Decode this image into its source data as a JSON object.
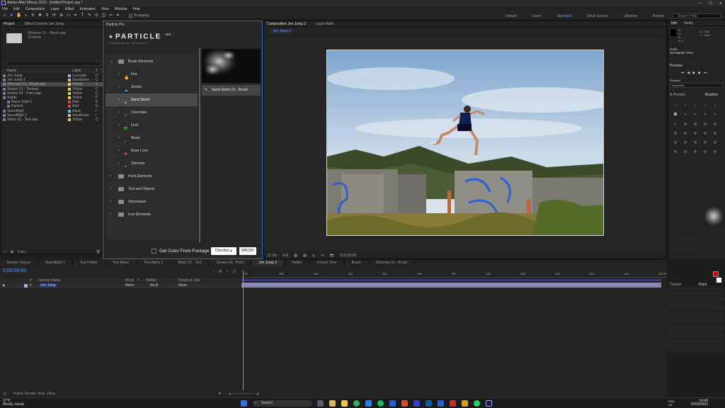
{
  "window": {
    "title": "Adobe After Effects 2023 - Untitled Project.aep *",
    "controls": [
      "—",
      "☐",
      "✕"
    ]
  },
  "menu": [
    "File",
    "Edit",
    "Composition",
    "Layer",
    "Effect",
    "Animation",
    "View",
    "Window",
    "Help"
  ],
  "toolbar": {
    "snapping": "Snapping"
  },
  "workspaces": {
    "items": [
      "Default",
      "Learn",
      "Standard",
      "Small Screen",
      "Libraries",
      "Review"
    ],
    "active": "Standard",
    "search_placeholder": "Search Help"
  },
  "project": {
    "tabs": [
      "Project",
      "Effect Controls Jon Jump"
    ],
    "selected_name": "Shimmer 01 - Brush.aep",
    "selected_info": "12 items",
    "header": {
      "name": "Name",
      "label": "Label",
      "type": "T"
    },
    "rows": [
      {
        "name": "Jon Jump",
        "label": "Lavender",
        "color": "#b7a6de",
        "type": "C"
      },
      {
        "name": "Jon Jump 2",
        "label": "Sandstone",
        "color": "#d8c08a",
        "type": "C"
      },
      {
        "name": "Shimmer 01 - Brush.aep",
        "label": "Yellow",
        "color": "#e3d24a",
        "type": "C"
      },
      {
        "name": "Smoke 01 - Textaep",
        "label": "Yellow",
        "color": "#e3d24a",
        "type": "C"
      },
      {
        "name": "Smoke 03 - Point.aep",
        "label": "Yellow",
        "color": "#e3d24a",
        "type": "C"
      },
      {
        "name": "Solids",
        "label": "Yellow",
        "color": "#e3d24a",
        "type": "F"
      },
      {
        "name": "Black Solid 1",
        "label": "Red",
        "color": "#d14b4b",
        "type": "S"
      },
      {
        "name": "Particle",
        "label": "Red",
        "color": "#d14b4b",
        "type": "S"
      },
      {
        "name": "Swordfight",
        "label": "Aqua",
        "color": "#4bc4d1",
        "type": "I"
      },
      {
        "name": "Swordfight 2",
        "label": "Sandstone",
        "color": "#d8c08a",
        "type": "I"
      },
      {
        "name": "Water 01 - Text.aep",
        "label": "Yellow",
        "color": "#e3d24a",
        "type": "C"
      }
    ],
    "footer": "8 bpc"
  },
  "particle": {
    "tab": "Particle Pro",
    "logo": "PARTICLE",
    "logo_sup": "PRO",
    "subtitle": "POWERED BY STARDUST",
    "tree": [
      {
        "label": "Brush Elements",
        "level": 0,
        "expanded": true
      },
      {
        "label": "Fire",
        "level": 1,
        "icon": "🔥",
        "icon_color": "#ff6a1a"
      },
      {
        "label": "Smoke",
        "level": 1,
        "icon": "☁",
        "icon_color": "#5ca0ff"
      },
      {
        "label": "Sand Storm",
        "level": 1,
        "icon": "✦",
        "icon_color": "#d8a64a",
        "selected": true
      },
      {
        "label": "Chocolate",
        "level": 1,
        "icon": "✎",
        "icon_color": "#c0703a"
      },
      {
        "label": "Fruit",
        "level": 1,
        "icon": "✿",
        "icon_color": "#4bd15a"
      },
      {
        "label": "Music",
        "level": 1,
        "icon": "♪",
        "icon_color": "#e08a3a"
      },
      {
        "label": "Rose Love",
        "level": 1,
        "icon": "❀",
        "icon_color": "#e05a5a"
      },
      {
        "label": "Shimmer",
        "level": 1,
        "icon": "✧",
        "icon_color": "#bfbfbf"
      },
      {
        "label": "Point Elements",
        "level": 0
      },
      {
        "label": "Text and Objects",
        "level": 0
      },
      {
        "label": "Shockwave",
        "level": 0
      },
      {
        "label": "Icon Elements",
        "level": 0
      }
    ],
    "preview_label": "Sand Storm 01 - Brush",
    "get_color": "Get Color From Footage",
    "direction": "Direction",
    "brush": "BRUSH"
  },
  "composition": {
    "tabs": [
      "Composition Jon Jump 2",
      "Layer Work"
    ],
    "sub_tab": "Jon Jump 2",
    "footer": {
      "zoom": "12.5%",
      "quality": "Full",
      "timecode": "0;00;00;00"
    }
  },
  "info": {
    "tabs": [
      "Info",
      "Audio"
    ],
    "readout": [
      "R:",
      "G:",
      "B:",
      "A: 0"
    ],
    "xy": [
      "X: 1752",
      "Y: -1118"
    ],
    "undo_title": "Undo",
    "undo_action": "Set Marker Time",
    "preview": "Preview",
    "shortcut_label": "Shortcut",
    "shortcut_value": "Spacebar",
    "presets_tab": "& Presets",
    "brushes_tab": "Brushes",
    "tracker_tab": "Tracker",
    "paint_tab": "Paint",
    "fg_color": "#e00000",
    "bg_color": "#ffffff"
  },
  "timeline": {
    "tabs": [
      "Render Queue",
      "Swordfight 2",
      "Text Holder",
      "Text Alpha",
      "Text Alpha 2",
      "Water 01 - Text",
      "Smoke 03 - Point",
      "Jon Jump 2",
      "Holder",
      "Freeze Time",
      "Brush",
      "Shimmer 01 - Brush"
    ],
    "active_tab": "Jon Jump 2",
    "timecode": "0;00;00;00",
    "columns": [
      "#",
      "Source Name",
      "Mode",
      "T",
      "TrkMat",
      "Parent & Link"
    ],
    "layer": {
      "num": "1",
      "name": "Jon Jump",
      "mode": "Norm",
      "trkmat": "No B",
      "parent": "None"
    },
    "ruler": [
      "0s",
      "05s",
      "10s",
      "15s",
      "20s",
      "25s",
      "30s",
      "35s",
      "40s",
      "45s",
      "50s",
      "55s",
      "01:00"
    ],
    "footer": "Frame Render Time: 13ms"
  },
  "taskbar": {
    "weather_temp": "17°C",
    "weather_desc": "Mostly cloudy",
    "search": "Search",
    "time": "14:40",
    "date": "10/05/2023",
    "lang": "ENG UK"
  }
}
